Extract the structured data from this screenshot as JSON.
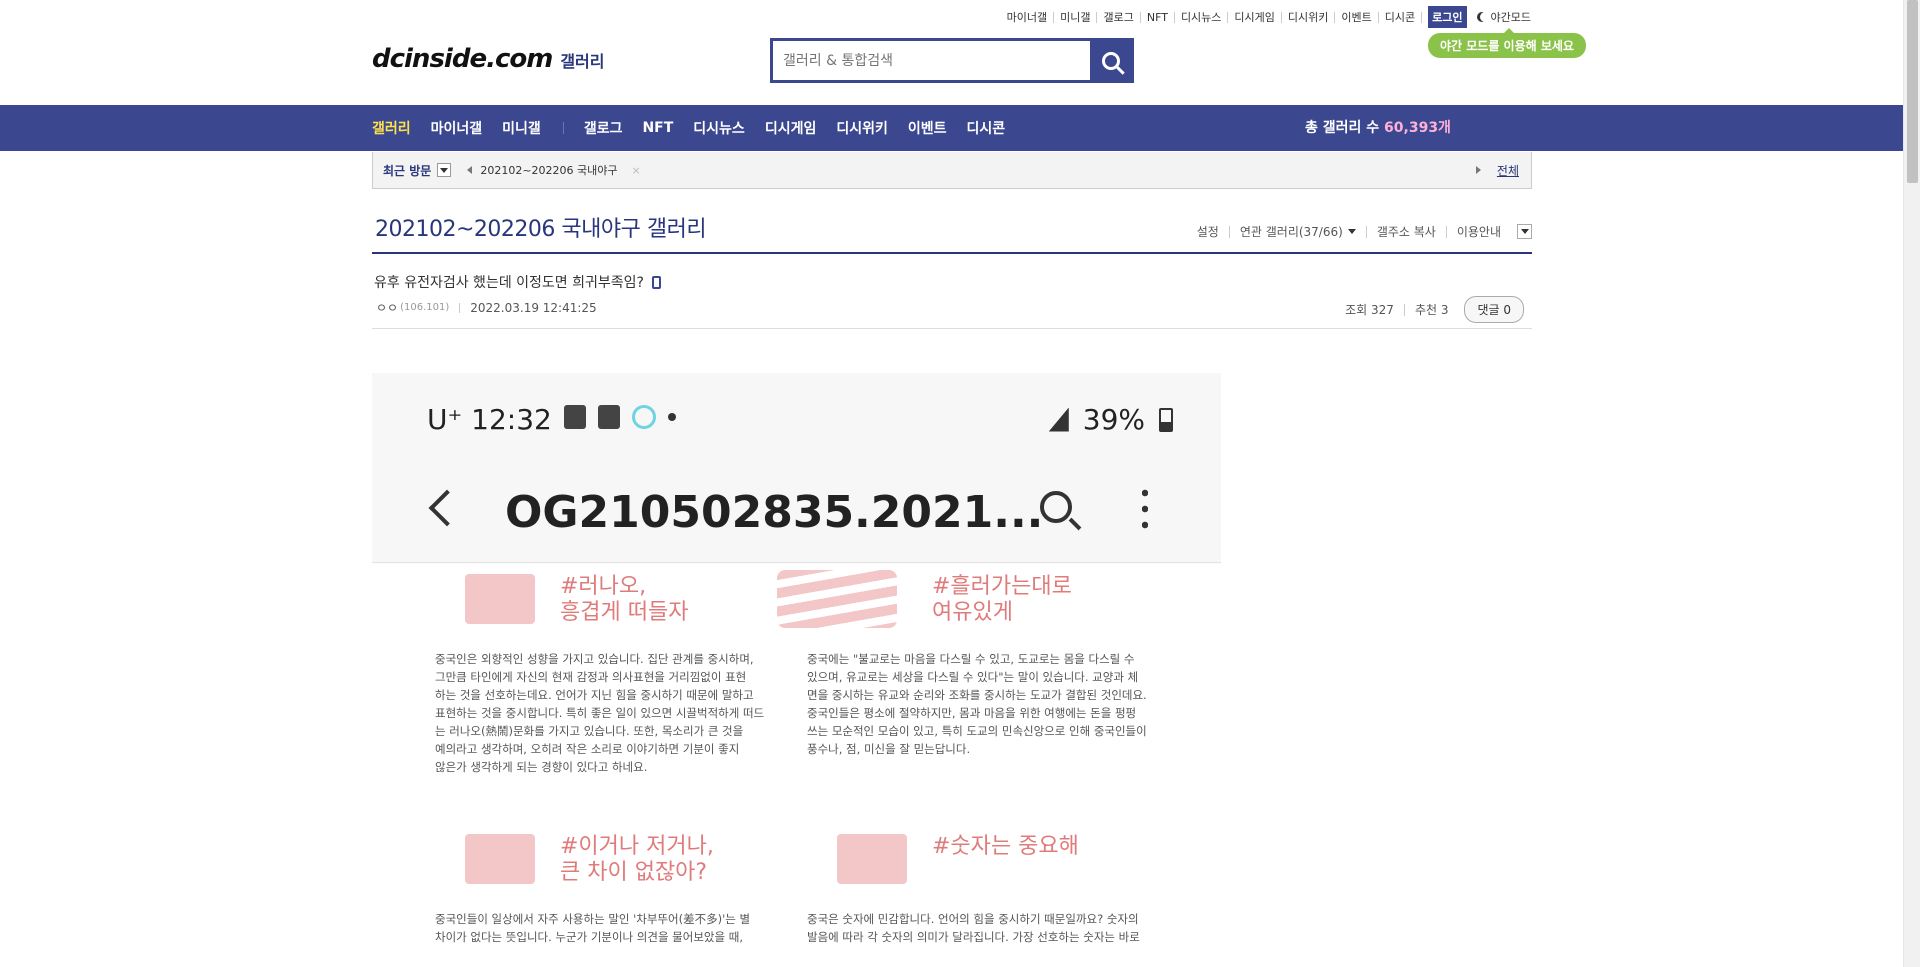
{
  "topnav": {
    "items": [
      "마이너갤",
      "미니갤",
      "갤로그",
      "NFT",
      "디시뉴스",
      "디시게임",
      "디시위키",
      "이벤트",
      "디시콘"
    ],
    "login": "로그인",
    "night_mode": "야간모드",
    "night_tip": "야간 모드를 이용해 보세요"
  },
  "logo": {
    "brand": "dcinside.com",
    "sub": "갤러리"
  },
  "search": {
    "placeholder": "갤러리 & 통합검색",
    "button_icon": "search-icon"
  },
  "gnb": {
    "items": [
      "갤러리",
      "마이너갤",
      "미니갤",
      "갤로그",
      "NFT",
      "디시뉴스",
      "디시게임",
      "디시위키",
      "이벤트",
      "디시콘"
    ],
    "total_label": "총 갤러리 수 ",
    "total_value": "60,393개"
  },
  "recent": {
    "label": "최근 방문",
    "visit": "202102~202206 국내야구",
    "close": "×",
    "all": "전체"
  },
  "gallery": {
    "title": "202102~202206 국내야구 갤러리",
    "tools": [
      "설정",
      "연관 갤러리(37/66)",
      "갤주소 복사",
      "이용안내"
    ]
  },
  "post": {
    "subject": "유후 유전자검사 했는데 이정도면 희귀부족임?",
    "writer": "ㅇㅇ",
    "ip": "(106.101)",
    "date": "2022.03.19 12:41:25",
    "views": "조회 327",
    "recommend": "추천 3",
    "reply": "댓글 0"
  },
  "image": {
    "carrier": "U⁺ 12:32",
    "battery": "39%",
    "filename": "OG210502835.2021...",
    "cards": [
      {
        "hashtag": "#러나오,\n흥겹게 떠들자",
        "lines": [
          "중국인은 외향적인 성향을 가지고 있습니다. 집단 관계를 중시하며,",
          "그만큼 타인에게 자신의 현재 감정과 의사표현을 거리낌없이 표현",
          "하는 것을 선호하는데요. 언어가 지닌 힘을 중시하기 때문에 말하고",
          "표현하는 것을 중시합니다. 특히 좋은 일이 있으면 시끌벅적하게 떠드",
          "는 러나오(熱鬧)문화를 가지고 있습니다. 또한, 목소리가 큰 것을",
          "예의라고 생각하며, 오히려 작은 소리로 이야기하면 기분이 좋지",
          "않은가 생각하게 되는 경향이 있다고 하네요."
        ]
      },
      {
        "hashtag": "#흘러가는대로\n여유있게",
        "lines": [
          "중국에는 \"불교로는 마음을 다스릴 수 있고, 도교로는 몸을 다스릴 수",
          "있으며, 유교로는 세상을 다스릴 수 있다\"는 말이 있습니다. 교양과 체",
          "면을 중시하는 유교와 순리와 조화를 중시하는 도교가 결합된 것인데요.",
          "중국인들은 평소에 절약하지만, 몸과 마음을 위한 여행에는 돈을 펑펑",
          "쓰는 모순적인 모습이 있고, 특히 도교의 민속신앙으로 인해 중국인들이",
          "풍수나, 점, 미신을 잘 믿는답니다."
        ]
      },
      {
        "hashtag": "#이거나 저거나,\n큰 차이 없잖아?",
        "lines": [
          "중국인들이 일상에서 자주 사용하는 말인 '차부뚜어(差不多)'는 별",
          "차이가 없다는 뜻입니다. 누군가 기분이나 의견을 물어보았을 때,"
        ]
      },
      {
        "hashtag": "#숫자는 중요해",
        "lines": [
          "중국은 숫자에 민감합니다. 언어의 힘을 중시하기 때문일까요? 숫자의",
          "발음에 따라 각 숫자의 의미가 달라집니다. 가장 선호하는 숫자는 바로"
        ]
      }
    ]
  },
  "colors": {
    "primary": "#3b4890",
    "accent_yellow": "#ffe14a",
    "tip_green": "#8bc34a",
    "pink": "#e07b7b"
  }
}
